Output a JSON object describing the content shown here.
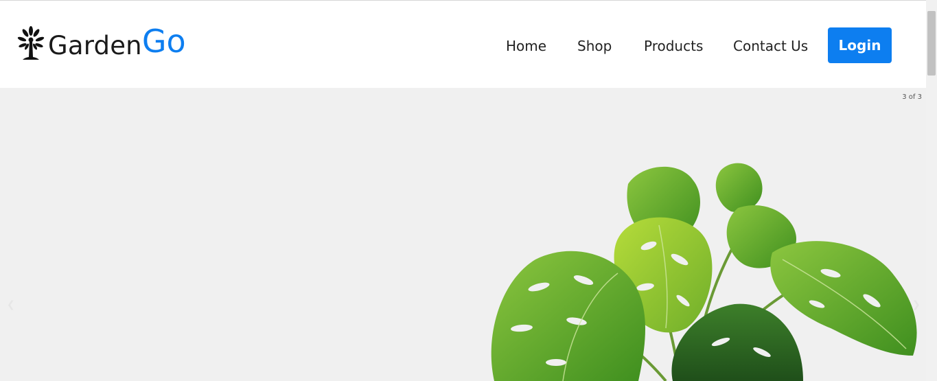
{
  "brand": {
    "name_part1": "Garden",
    "name_part2": "Go",
    "icon": "tree-icon",
    "accent_color": "#0d7ef0"
  },
  "nav": {
    "links": [
      {
        "label": "Home"
      },
      {
        "label": "Shop"
      },
      {
        "label": "Products"
      },
      {
        "label": "Contact Us"
      }
    ],
    "login_label": "Login"
  },
  "hero": {
    "slide_counter": "3 of 3",
    "prev_icon": "chevron-left-icon",
    "next_icon": "chevron-right-icon",
    "image": "monstera-plant-image",
    "background_color": "#f0f0f0"
  }
}
